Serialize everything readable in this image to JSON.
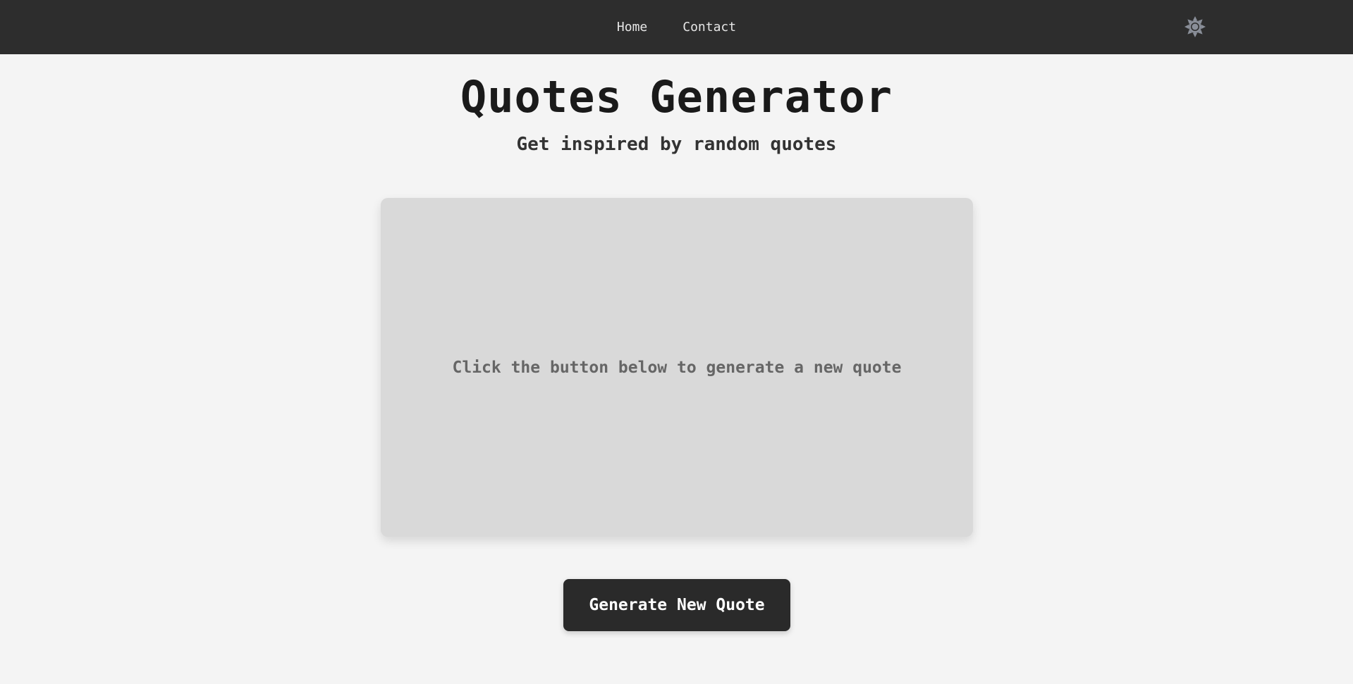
{
  "nav": {
    "links": [
      {
        "label": "Home"
      },
      {
        "label": "Contact"
      }
    ],
    "theme_toggle_icon": "sun-icon"
  },
  "header": {
    "title": "Quotes Generator",
    "subtitle": "Get inspired by random quotes"
  },
  "quote_card": {
    "text": "Click the button below to generate a new quote"
  },
  "actions": {
    "generate_label": "Generate New Quote"
  },
  "colors": {
    "navbar_bg": "#2d2d2d",
    "page_bg": "#f4f4f4",
    "card_bg": "#d9d9d9",
    "button_bg": "#2a2a2a",
    "icon_color": "#8a8f99"
  }
}
